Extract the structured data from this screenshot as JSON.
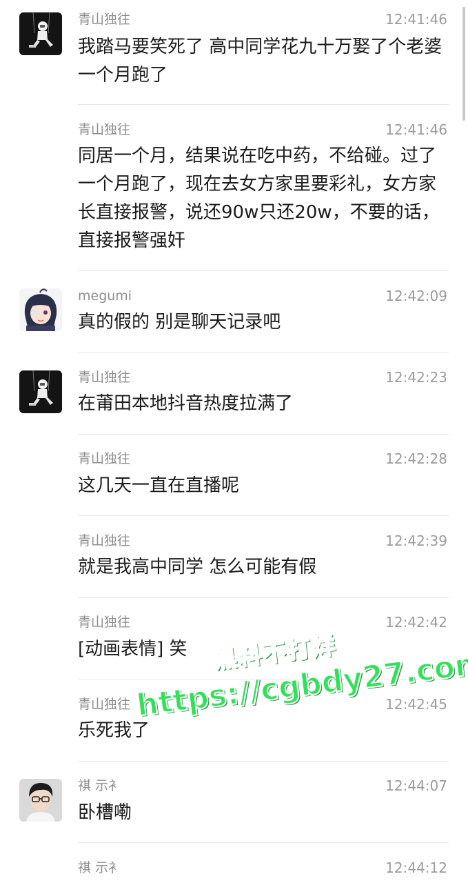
{
  "messages": [
    {
      "sender": "青山独往",
      "time": "12:41:46",
      "text": "我踏马要笑死了 高中同学花九十万娶了个老婆 一个月跑了",
      "avatar": "astronaut-avatar"
    },
    {
      "sender": "青山独往",
      "time": "12:41:46",
      "text": "同居一个月，结果说在吃中药，不给碰。过了一个月跑了，现在去女方家里要彩礼，女方家长直接报警，说还90w只还20w，不要的话，直接报警强奸"
    },
    {
      "sender": "megumi",
      "time": "12:42:09",
      "text": "真的假的  别是聊天记录吧",
      "avatar": "anime-girl-avatar"
    },
    {
      "sender": "青山独往",
      "time": "12:42:23",
      "text": "在莆田本地抖音热度拉满了",
      "avatar": "astronaut-avatar"
    },
    {
      "sender": "青山独往",
      "time": "12:42:28",
      "text": "这几天一直在直播呢"
    },
    {
      "sender": "青山独往",
      "time": "12:42:39",
      "text": "就是我高中同学 怎么可能有假"
    },
    {
      "sender": "青山独往",
      "time": "12:42:42",
      "text": "[动画表情] 笑"
    },
    {
      "sender": "青山独往",
      "time": "12:42:45",
      "text": "乐死我了"
    },
    {
      "sender": "祺 示衤",
      "time": "12:44:07",
      "text": "卧槽嘞",
      "avatar": "young-man-avatar"
    },
    {
      "sender": "祺 示衤",
      "time": "12:44:12",
      "text": ""
    }
  ],
  "watermark": {
    "line1": "黑料不打烊",
    "line2": "https://cgbdy27.com"
  },
  "colors": {
    "watermark_green": "#33e05a",
    "sender_gray": "#8f8f8f",
    "text_dark": "#1b1b1b"
  }
}
